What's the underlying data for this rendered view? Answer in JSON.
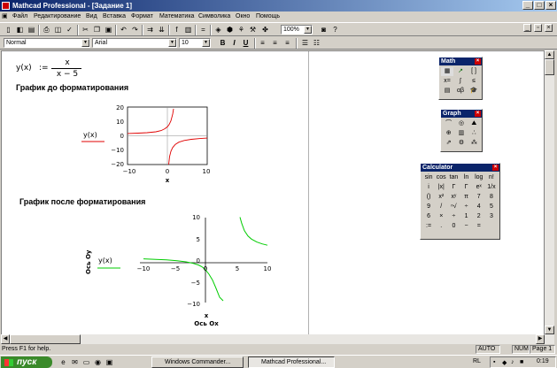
{
  "window": {
    "title": "Mathcad Professional - [Задание 1]",
    "app_icon": "mathcad-icon",
    "colors": {
      "title_start": "#0a246a",
      "title_end": "#a6caf0",
      "curve_before": "#e00000",
      "curve_after": "#00cc00"
    }
  },
  "menu": {
    "items": [
      "Файл",
      "Редактирование",
      "Вид",
      "Вставка",
      "Формат",
      "Математика",
      "Символика",
      "Окно",
      "Помощь"
    ]
  },
  "format_bar": {
    "style": "Normal",
    "font": "Arial",
    "size": "10",
    "bold": "B",
    "italic": "I",
    "underline": "U"
  },
  "toolbar": {
    "zoom": "100%",
    "help": "?"
  },
  "worksheet": {
    "func_lhs": "y(x)",
    "func_def": ":=",
    "func_num": "x",
    "func_den": "x − 5",
    "heading1": "График до форматирования",
    "heading2": "График после форматирования",
    "graph1": {
      "y_ticks": [
        "20",
        "10",
        "0",
        "−10",
        "−20"
      ],
      "x_ticks": [
        "−10",
        "0",
        "10"
      ],
      "y_legend": "y(x)",
      "x_label": "x"
    },
    "graph2": {
      "y_ticks": [
        "10",
        "5",
        "0",
        "−5",
        "−10"
      ],
      "x_ticks": [
        "−10",
        "−5",
        "0",
        "5",
        "10"
      ],
      "y_legend": "y(x)",
      "y_axis_title": "Ось Оу",
      "x_label": "x",
      "x_axis_title": "Ось Ох"
    }
  },
  "palettes": {
    "math": {
      "title": "Math",
      "close": "×"
    },
    "graph": {
      "title": "Graph",
      "close": "×"
    },
    "calculator": {
      "title": "Calculator",
      "close": "×",
      "keys": [
        "sin",
        "cos",
        "tan",
        "ln",
        "log",
        "n!",
        "i",
        "|x|",
        "Γ",
        "Γ",
        "eˣ",
        "1/x",
        "()",
        "x²",
        "xʸ",
        "π",
        "7",
        "8",
        "9",
        "/",
        "ⁿ√",
        "÷",
        "4",
        "5",
        "6",
        "×",
        "÷",
        "1",
        "2",
        "3",
        ":=",
        ".",
        "0",
        "−",
        "="
      ]
    }
  },
  "statusbar": {
    "help_text": "Press F1 for help.",
    "auto": "AUTO",
    "num": "NUM",
    "page": "Page 1"
  },
  "taskbar": {
    "start": "пуск",
    "tasks": [
      "Windows Commander...",
      "Mathcad Professional..."
    ],
    "lang": "RL",
    "clock": "0:19"
  }
}
